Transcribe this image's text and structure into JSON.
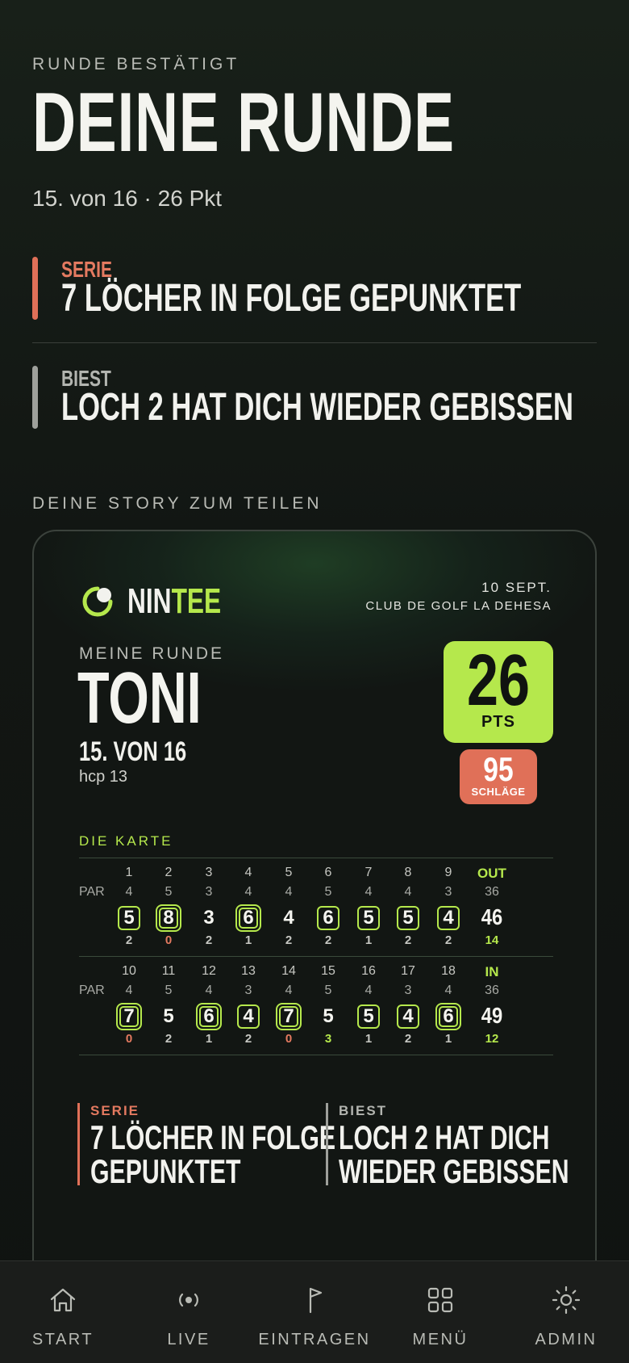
{
  "header": {
    "eyebrow": "RUNDE BESTÄTIGT",
    "title": "DEINE RUNDE",
    "subtitle": "15. von 16 · 26 Pkt"
  },
  "insights": [
    {
      "label": "SERIE",
      "text": "7 LÖCHER IN FOLGE GEPUNKTET",
      "color": "#e07058"
    },
    {
      "label": "BIEST",
      "text": "LOCH 2 HAT DICH WIEDER GEBISSEN",
      "color": "#9ea09b"
    }
  ],
  "story": {
    "heading": "DEINE STORY ZUM TEILEN",
    "brand_a": "NIN",
    "brand_b": "TEE",
    "date": "10 SEPT.",
    "club": "CLUB DE GOLF LA DEHESA",
    "eyebrow": "MEINE RUNDE",
    "name": "TONI",
    "rank": "15. VON 16",
    "hcp": "hcp 13",
    "points": "26",
    "points_unit": "PTS",
    "strokes": "95",
    "strokes_unit": "SCHLÄGE",
    "card_heading": "DIE KARTE",
    "par_label": "PAR",
    "front": {
      "total_label": "OUT",
      "par_total": "36",
      "score_total": "46",
      "points_total": "14",
      "holes": [
        {
          "n": "1",
          "par": "4",
          "score": "5",
          "pts": "2",
          "mark": "box"
        },
        {
          "n": "2",
          "par": "5",
          "score": "8",
          "pts": "0",
          "mark": "dbl"
        },
        {
          "n": "3",
          "par": "3",
          "score": "3",
          "pts": "2",
          "mark": "none"
        },
        {
          "n": "4",
          "par": "4",
          "score": "6",
          "pts": "1",
          "mark": "dbl"
        },
        {
          "n": "5",
          "par": "4",
          "score": "4",
          "pts": "2",
          "mark": "none"
        },
        {
          "n": "6",
          "par": "5",
          "score": "6",
          "pts": "2",
          "mark": "box"
        },
        {
          "n": "7",
          "par": "4",
          "score": "5",
          "pts": "1",
          "mark": "box"
        },
        {
          "n": "8",
          "par": "4",
          "score": "5",
          "pts": "2",
          "mark": "box"
        },
        {
          "n": "9",
          "par": "3",
          "score": "4",
          "pts": "2",
          "mark": "box"
        }
      ]
    },
    "back": {
      "total_label": "IN",
      "par_total": "36",
      "score_total": "49",
      "points_total": "12",
      "holes": [
        {
          "n": "10",
          "par": "4",
          "score": "7",
          "pts": "0",
          "mark": "dbl"
        },
        {
          "n": "11",
          "par": "5",
          "score": "5",
          "pts": "2",
          "mark": "none"
        },
        {
          "n": "12",
          "par": "4",
          "score": "6",
          "pts": "1",
          "mark": "dbl"
        },
        {
          "n": "13",
          "par": "3",
          "score": "4",
          "pts": "2",
          "mark": "box"
        },
        {
          "n": "14",
          "par": "4",
          "score": "7",
          "pts": "0",
          "mark": "dbl"
        },
        {
          "n": "15",
          "par": "5",
          "score": "5",
          "pts": "3",
          "mark": "none"
        },
        {
          "n": "16",
          "par": "4",
          "score": "5",
          "pts": "1",
          "mark": "box"
        },
        {
          "n": "17",
          "par": "3",
          "score": "4",
          "pts": "2",
          "mark": "box"
        },
        {
          "n": "18",
          "par": "4",
          "score": "6",
          "pts": "1",
          "mark": "dbl"
        }
      ]
    },
    "insights": [
      {
        "label": "SERIE",
        "line1": "7 LÖCHER IN FOLGE",
        "line2": "GEPUNKTET"
      },
      {
        "label": "BIEST",
        "line1": "LOCH 2 HAT DICH",
        "line2": "WIEDER GEBISSEN"
      }
    ]
  },
  "tabs": [
    {
      "label": "START",
      "icon": "home-icon"
    },
    {
      "label": "LIVE",
      "icon": "live-icon"
    },
    {
      "label": "EINTRAGEN",
      "icon": "flag-icon"
    },
    {
      "label": "MENÜ",
      "icon": "grid-icon"
    },
    {
      "label": "ADMIN",
      "icon": "sun-icon"
    }
  ],
  "colors": {
    "accent": "#b5e84c",
    "alert": "#e07058",
    "neutral": "#9ea09b",
    "background": "#121613"
  }
}
